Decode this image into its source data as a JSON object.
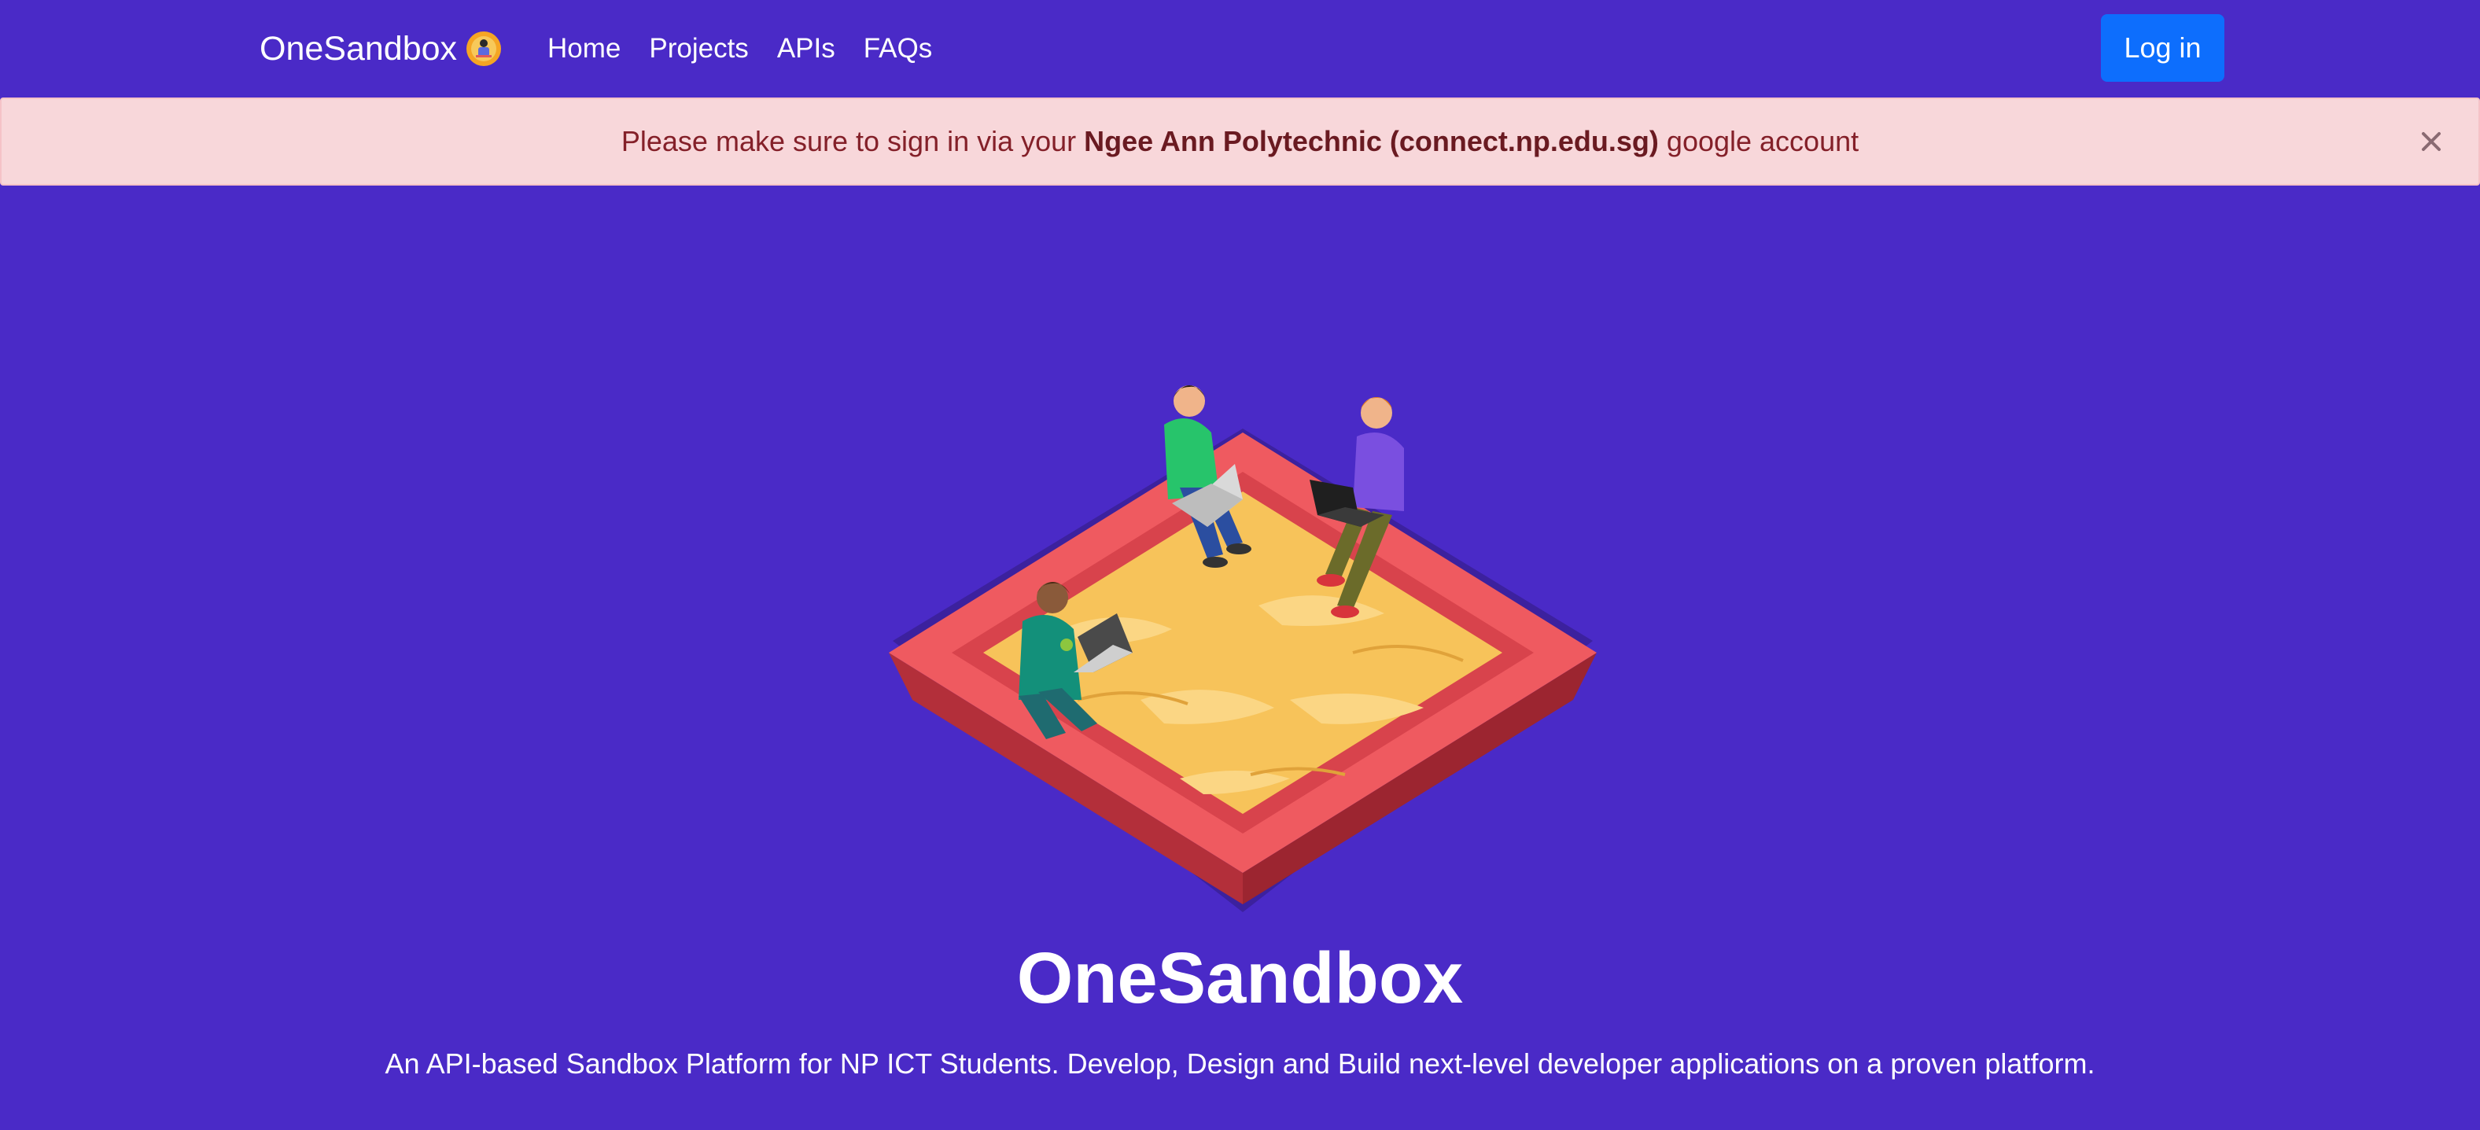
{
  "navbar": {
    "brand": "OneSandbox",
    "brand_icon": "sandbox-logo-icon",
    "links": [
      {
        "label": "Home"
      },
      {
        "label": "Projects"
      },
      {
        "label": "APIs"
      },
      {
        "label": "FAQs"
      }
    ],
    "login_label": "Log in"
  },
  "alert": {
    "prefix": "Please make sure to sign in via your ",
    "emphasis": "Ngee Ann Polytechnic (connect.np.edu.sg)",
    "suffix": " google account",
    "close_icon": "close-icon"
  },
  "hero": {
    "illustration": "sandbox-illustration",
    "title": "OneSandbox",
    "subtitle": "An API-based Sandbox Platform for NP ICT Students. Develop, Design and Build next-level developer applications on a proven platform."
  },
  "colors": {
    "background": "#4a2ac7",
    "primary_button": "#0d6efd",
    "alert_bg": "#f8d7da",
    "alert_text": "#842029"
  }
}
